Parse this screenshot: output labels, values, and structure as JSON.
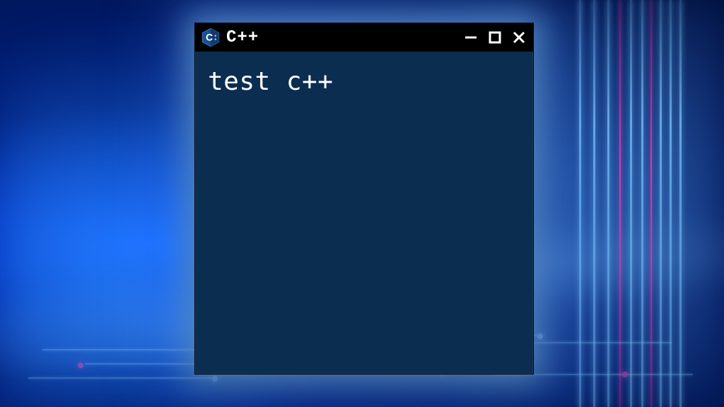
{
  "window": {
    "title": "C++",
    "icon": "cpp-hex-icon"
  },
  "console": {
    "output": "test c++"
  },
  "colors": {
    "window_bg": "#0b2d4f",
    "titlebar_bg": "#000000",
    "text": "#ffffff"
  }
}
